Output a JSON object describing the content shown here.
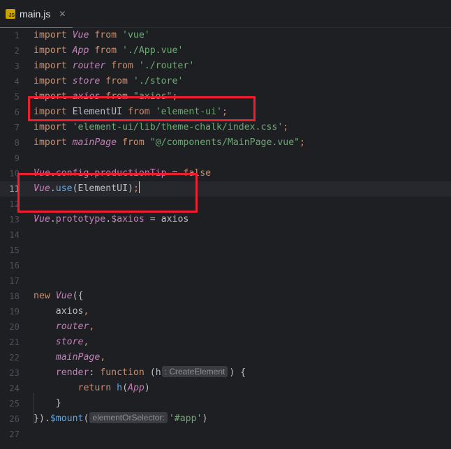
{
  "tab": {
    "icon": "js-file-icon",
    "icon_text": "JS",
    "filename": "main.js",
    "close_glyph": "✕"
  },
  "editor": {
    "current_line": 11,
    "lines": [
      {
        "n": "1",
        "tokens": [
          [
            "kw",
            "import "
          ],
          [
            "cls",
            "Vue"
          ],
          [
            "kw",
            " from "
          ],
          [
            "str",
            "'vue'"
          ]
        ]
      },
      {
        "n": "2",
        "tokens": [
          [
            "kw",
            "import "
          ],
          [
            "cls",
            "App"
          ],
          [
            "kw",
            " from "
          ],
          [
            "str",
            "'./App.vue'"
          ]
        ]
      },
      {
        "n": "3",
        "tokens": [
          [
            "kw",
            "import "
          ],
          [
            "cls",
            "router"
          ],
          [
            "kw",
            " from "
          ],
          [
            "str",
            "'./router'"
          ]
        ]
      },
      {
        "n": "4",
        "tokens": [
          [
            "kw",
            "import "
          ],
          [
            "cls",
            "store"
          ],
          [
            "kw",
            " from "
          ],
          [
            "str",
            "'./store'"
          ]
        ]
      },
      {
        "n": "5",
        "tokens": [
          [
            "kw",
            "import "
          ],
          [
            "cls",
            "axios"
          ],
          [
            "kw",
            " from "
          ],
          [
            "str",
            "\"axios\""
          ],
          [
            "kw",
            ";"
          ]
        ]
      },
      {
        "n": "6",
        "tokens": [
          [
            "kw",
            "import "
          ],
          [
            "plain",
            "ElementUI"
          ],
          [
            "kw",
            " from "
          ],
          [
            "str",
            "'element-ui'"
          ],
          [
            "kw",
            ";"
          ]
        ]
      },
      {
        "n": "7",
        "tokens": [
          [
            "kw",
            "import "
          ],
          [
            "str",
            "'element-ui/lib/theme-chalk/index.css'"
          ],
          [
            "kw",
            ";"
          ]
        ]
      },
      {
        "n": "8",
        "tokens": [
          [
            "kw",
            "import "
          ],
          [
            "cls",
            "mainPage"
          ],
          [
            "kw",
            " from "
          ],
          [
            "str",
            "\"@/components/MainPage.vue\""
          ],
          [
            "kw",
            ";"
          ]
        ]
      },
      {
        "n": "9",
        "tokens": []
      },
      {
        "n": "10",
        "tokens": [
          [
            "cls",
            "Vue"
          ],
          [
            "plain",
            "."
          ],
          [
            "prop",
            "config"
          ],
          [
            "plain",
            "."
          ],
          [
            "prop",
            "productionTip"
          ],
          [
            "plain",
            " = "
          ],
          [
            "kw",
            "false"
          ]
        ]
      },
      {
        "n": "11",
        "tokens": [
          [
            "cls",
            "Vue"
          ],
          [
            "plain",
            "."
          ],
          [
            "fn",
            "use"
          ],
          [
            "plain",
            "(ElementUI)"
          ],
          [
            "kw",
            ";"
          ],
          [
            "caret",
            ""
          ]
        ]
      },
      {
        "n": "12",
        "tokens": []
      },
      {
        "n": "13",
        "tokens": [
          [
            "cls",
            "Vue"
          ],
          [
            "plain",
            "."
          ],
          [
            "prop",
            "prototype"
          ],
          [
            "plain",
            "."
          ],
          [
            "prop",
            "$axios"
          ],
          [
            "plain",
            " = axios"
          ]
        ]
      },
      {
        "n": "14",
        "tokens": []
      },
      {
        "n": "15",
        "tokens": []
      },
      {
        "n": "16",
        "tokens": []
      },
      {
        "n": "17",
        "tokens": []
      },
      {
        "n": "18",
        "tokens": [
          [
            "kw",
            "new "
          ],
          [
            "cls",
            "Vue"
          ],
          [
            "plain",
            "({"
          ]
        ]
      },
      {
        "n": "19",
        "tokens": [
          [
            "plain",
            "    axios"
          ],
          [
            "kw",
            ","
          ]
        ]
      },
      {
        "n": "20",
        "tokens": [
          [
            "plain",
            "    "
          ],
          [
            "cls",
            "router"
          ],
          [
            "kw",
            ","
          ]
        ]
      },
      {
        "n": "21",
        "tokens": [
          [
            "plain",
            "    "
          ],
          [
            "cls",
            "store"
          ],
          [
            "kw",
            ","
          ]
        ]
      },
      {
        "n": "22",
        "tokens": [
          [
            "plain",
            "    "
          ],
          [
            "cls",
            "mainPage"
          ],
          [
            "kw",
            ","
          ]
        ]
      },
      {
        "n": "23",
        "tokens": [
          [
            "plain",
            "    "
          ],
          [
            "prop",
            "render"
          ],
          [
            "plain",
            ": "
          ],
          [
            "kw",
            "function "
          ],
          [
            "plain",
            "(h"
          ],
          [
            "hint",
            ": CreateElement"
          ],
          [
            "plain",
            ") {"
          ]
        ]
      },
      {
        "n": "24",
        "tokens": [
          [
            "plain",
            "        "
          ],
          [
            "kw",
            "return "
          ],
          [
            "fn",
            "h"
          ],
          [
            "plain",
            "("
          ],
          [
            "cls",
            "App"
          ],
          [
            "plain",
            ")"
          ]
        ]
      },
      {
        "n": "25",
        "tokens": [
          [
            "plain",
            "    }"
          ]
        ]
      },
      {
        "n": "26",
        "tokens": [
          [
            "plain",
            "})."
          ],
          [
            "fn",
            "$mount"
          ],
          [
            "plain",
            "("
          ],
          [
            "hint",
            "elementOrSelector:"
          ],
          [
            "str",
            "'#app'"
          ],
          [
            "plain",
            ")"
          ]
        ]
      },
      {
        "n": "27",
        "tokens": []
      }
    ]
  },
  "annotations": [
    {
      "label": "red-box-import-element-ui",
      "color": "#ef1d30"
    },
    {
      "label": "red-box-vue-use-element-ui",
      "color": "#ef1d30"
    }
  ],
  "colors": {
    "background": "#1e1f22",
    "keyword": "#cf8e6d",
    "string": "#6aab73",
    "identifier": "#c77dbb",
    "function": "#56a8f5",
    "text": "#bcbec4",
    "annotation": "#ef1d30",
    "tab_underline": "#3574f0"
  }
}
